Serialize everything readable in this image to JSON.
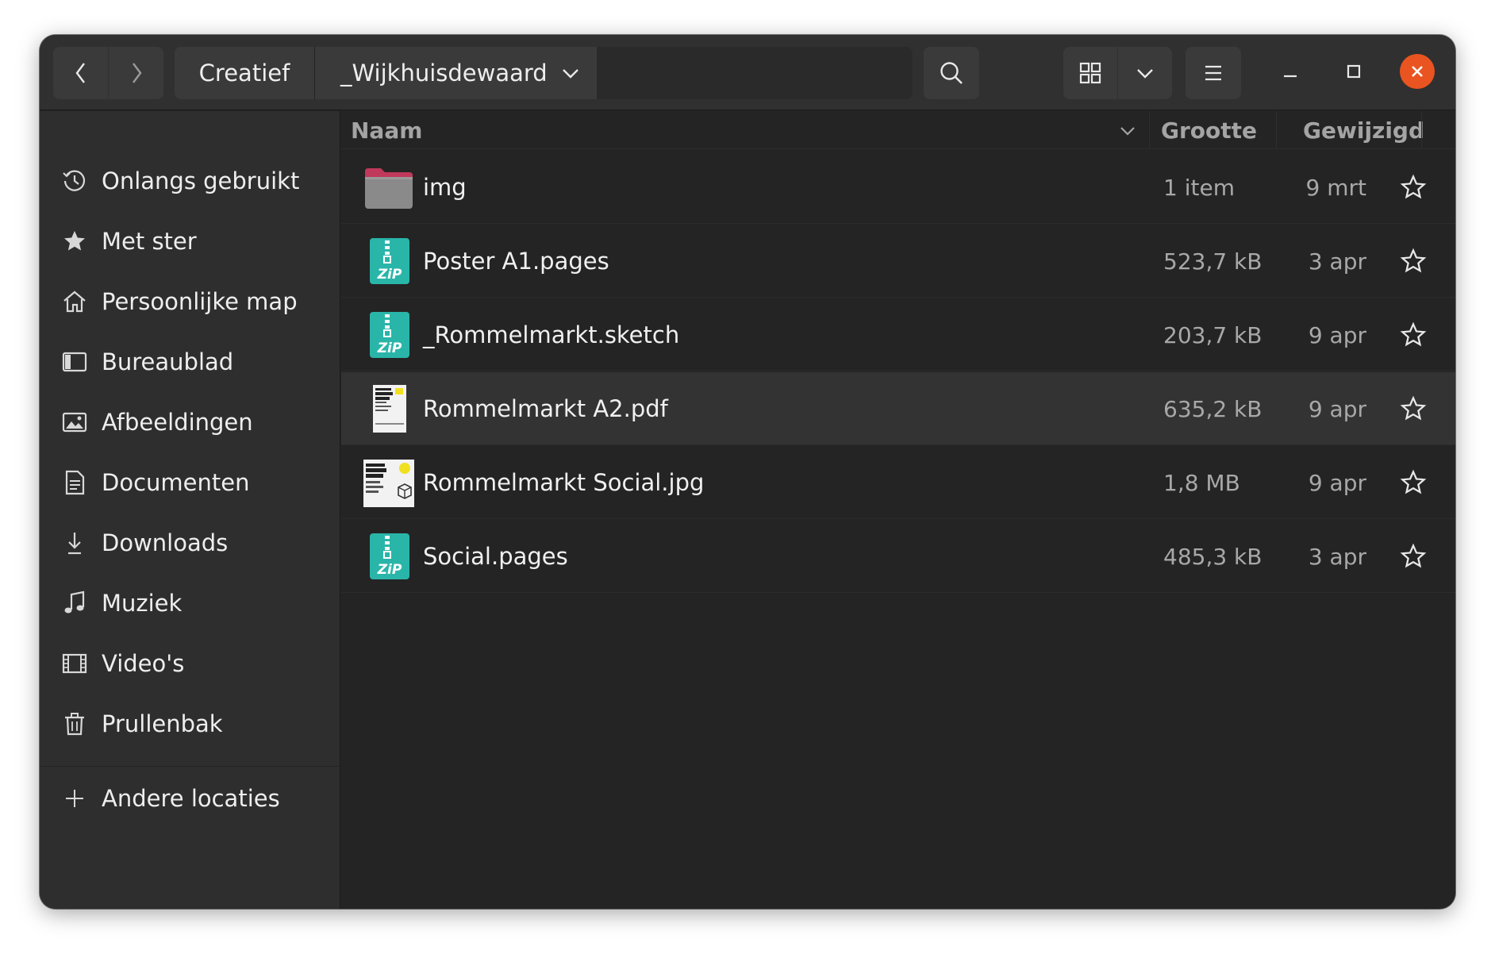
{
  "breadcrumb": {
    "parent": "Creatief",
    "current": "_Wijkhuisdewaard"
  },
  "icons": {
    "back": "chevron-left-icon",
    "forward": "chevron-right-icon",
    "search": "search-icon",
    "grid": "grid-view-icon",
    "dropdown": "chevron-down-icon",
    "menu": "hamburger-menu-icon",
    "minimize": "minimize-icon",
    "maximize": "maximize-icon",
    "close": "close-icon"
  },
  "colors": {
    "close_button": "#e95420",
    "folder": "#8a8a8a",
    "folder_tab": "#c0395a",
    "zip": "#2ab5a9"
  },
  "sidebar": {
    "items": [
      {
        "label": "Onlangs gebruikt",
        "icon": "clock-icon"
      },
      {
        "label": "Met ster",
        "icon": "star-icon"
      },
      {
        "label": "Persoonlijke map",
        "icon": "home-icon"
      },
      {
        "label": "Bureaublad",
        "icon": "desktop-icon"
      },
      {
        "label": "Afbeeldingen",
        "icon": "image-icon"
      },
      {
        "label": "Documenten",
        "icon": "document-icon"
      },
      {
        "label": "Downloads",
        "icon": "download-icon"
      },
      {
        "label": "Muziek",
        "icon": "music-icon"
      },
      {
        "label": "Video's",
        "icon": "video-icon"
      },
      {
        "label": "Prullenbak",
        "icon": "trash-icon"
      }
    ],
    "other_locations": "Andere locaties"
  },
  "columns": {
    "name": "Naam",
    "size": "Grootte",
    "modified": "Gewijzigd"
  },
  "files": [
    {
      "name": "img",
      "size": "1 item",
      "modified": "9 mrt",
      "type": "folder"
    },
    {
      "name": "Poster A1.pages",
      "size": "523,7 kB",
      "modified": "3 apr",
      "type": "zip"
    },
    {
      "name": "_Rommelmarkt.sketch",
      "size": "203,7 kB",
      "modified": "9 apr",
      "type": "zip"
    },
    {
      "name": "Rommelmarkt A2.pdf",
      "size": "635,2 kB",
      "modified": "9 apr",
      "type": "pdf",
      "selected": true
    },
    {
      "name": "Rommelmarkt Social.jpg",
      "size": "1,8 MB",
      "modified": "9 apr",
      "type": "jpg"
    },
    {
      "name": "Social.pages",
      "size": "485,3 kB",
      "modified": "3 apr",
      "type": "zip"
    }
  ]
}
